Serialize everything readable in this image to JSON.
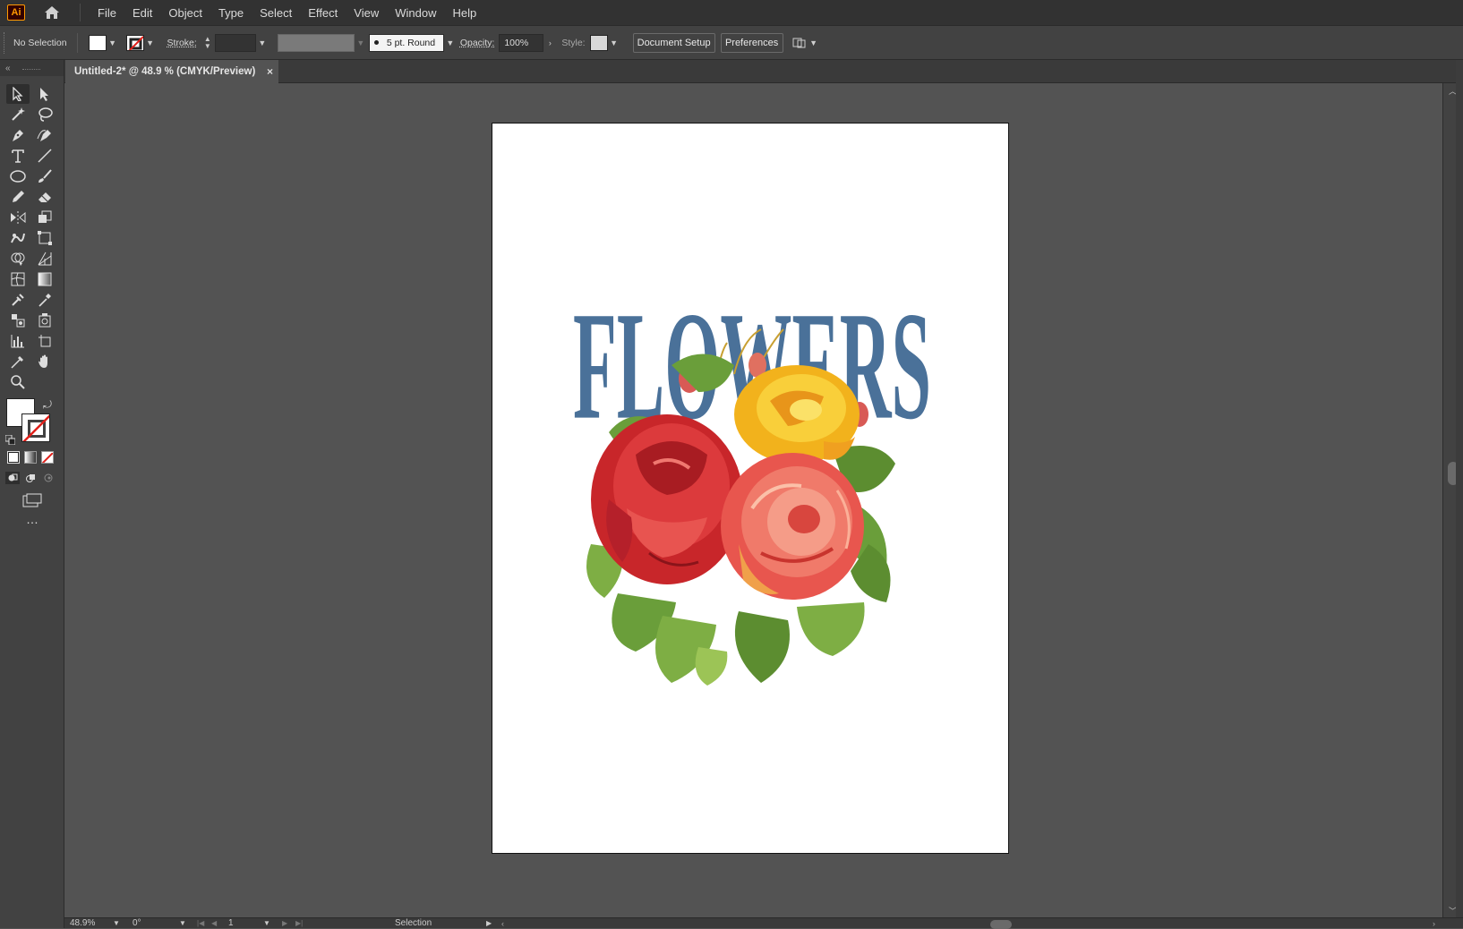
{
  "app": {
    "logo_text": "Ai",
    "accent": "#ff9a00"
  },
  "menu": {
    "items": [
      "File",
      "Edit",
      "Object",
      "Type",
      "Select",
      "Effect",
      "View",
      "Window",
      "Help"
    ]
  },
  "control_bar": {
    "selection_status": "No Selection",
    "stroke_label": "Stroke:",
    "brush_label": "5 pt. Round",
    "opacity_label": "Opacity:",
    "opacity_value": "100%",
    "style_label": "Style:",
    "document_setup": "Document Setup",
    "preferences": "Preferences"
  },
  "document": {
    "tab_title": "Untitled-2* @ 48.9 % (CMYK/Preview)",
    "close_glyph": "×"
  },
  "artwork": {
    "headline": "FLOWERS",
    "headline_color": "#4a7199"
  },
  "status": {
    "zoom": "48.9%",
    "rotation": "0°",
    "artboard_number": "1",
    "tool_name": "Selection"
  },
  "toolbar": {
    "more_tools_glyph": "…"
  }
}
